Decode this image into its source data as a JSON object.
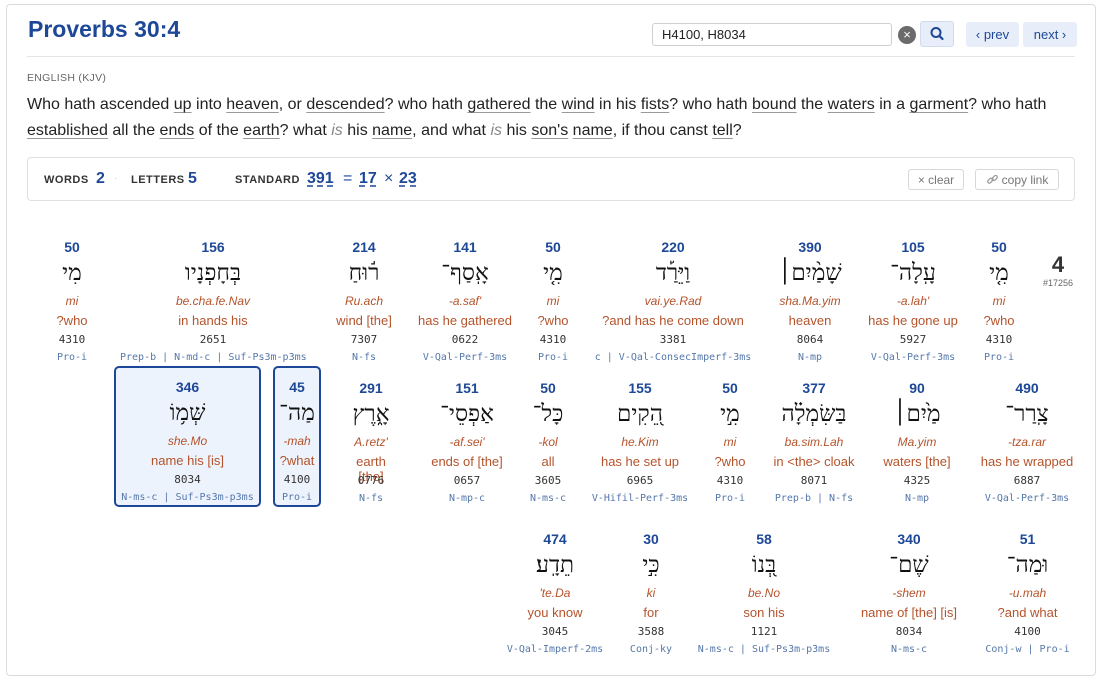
{
  "header": {
    "title": "Proverbs 30:4",
    "search_value": "H4100, H8034",
    "prev_label": "‹ prev",
    "next_label": "next ›"
  },
  "verse": {
    "language_label": "ENGLISH (KJV)",
    "segments": [
      {
        "t": "Who hath ascended "
      },
      {
        "t": "up",
        "k": true
      },
      {
        "t": " into "
      },
      {
        "t": "heaven",
        "k": true
      },
      {
        "t": ", or "
      },
      {
        "t": "descended",
        "k": true
      },
      {
        "t": "? who hath "
      },
      {
        "t": "gathered",
        "k": true
      },
      {
        "t": " the "
      },
      {
        "t": "wind",
        "k": true
      },
      {
        "t": " in his "
      },
      {
        "t": "fists",
        "k": true
      },
      {
        "t": "? who hath "
      },
      {
        "t": "bound",
        "k": true
      },
      {
        "t": " the "
      },
      {
        "t": "waters",
        "k": true
      },
      {
        "t": " in a "
      },
      {
        "t": "garment",
        "k": true
      },
      {
        "t": "? who hath "
      },
      {
        "t": "established",
        "k": true
      },
      {
        "t": " all the "
      },
      {
        "t": "ends",
        "k": true
      },
      {
        "t": " of the "
      },
      {
        "t": "earth",
        "k": true
      },
      {
        "t": "? what "
      },
      {
        "t": "is",
        "i": true
      },
      {
        "t": " his "
      },
      {
        "t": "name",
        "k": true
      },
      {
        "t": ", and what "
      },
      {
        "t": "is",
        "i": true
      },
      {
        "t": " his "
      },
      {
        "t": "son's",
        "k": true
      },
      {
        "t": " "
      },
      {
        "t": "name",
        "k": true
      },
      {
        "t": ", if thou canst "
      },
      {
        "t": "tell",
        "k": true
      },
      {
        "t": "?"
      }
    ]
  },
  "stats": {
    "words_label": "WORDS",
    "words_value": "2",
    "letters_label": "LETTERS",
    "letters_value": "5",
    "standard_label": "STANDARD",
    "standard_value": "391",
    "eq": "=",
    "factor1": "17",
    "times": "×",
    "factor2": "23",
    "clear_label": "× clear",
    "copy_label": "copy link"
  },
  "verse_number": "4",
  "verse_total": "#17256",
  "words": [
    {
      "value": "50",
      "hebrew": "מִי",
      "translit": "mi",
      "gloss": "?who",
      "strongs": "4310",
      "morph": "Pro-i",
      "selected": false
    },
    {
      "value": "156",
      "hebrew": "בְּחָפְנָיו",
      "translit": "be.cha.fe.Nav",
      "gloss": "in hands his",
      "strongs": "2651",
      "morph": "Prep-b | N-md-c | Suf-Ps3m-p3ms",
      "selected": false
    },
    {
      "value": "214",
      "hebrew": "ר֬וּחַ",
      "translit": "Ru.ach",
      "gloss": "wind [the]",
      "strongs": "7307",
      "morph": "N-fs",
      "selected": false
    },
    {
      "value": "141",
      "hebrew": "אָֽסַף־",
      "translit": "-a.saf'",
      "gloss": "has he gathered",
      "strongs": "0622",
      "morph": "V-Qal-Perf-3ms",
      "selected": false
    },
    {
      "value": "50",
      "hebrew": "מִ֤י",
      "translit": "mi",
      "gloss": "?who",
      "strongs": "4310",
      "morph": "Pro-i",
      "selected": false
    },
    {
      "value": "220",
      "hebrew": "וַיֵּרַ֡ד",
      "translit": "vai.ye.Rad",
      "gloss": "?and has he come down",
      "strongs": "3381",
      "morph": "c | V-Qal-ConsecImperf-3ms",
      "selected": false
    },
    {
      "value": "390",
      "hebrew": "שָׁמַ֨יִם׀",
      "translit": "sha.Ma.yim",
      "gloss": "heaven",
      "strongs": "8064",
      "morph": "N-mp",
      "selected": false
    },
    {
      "value": "105",
      "hebrew": "עָֽלָה־",
      "translit": "-a.lah'",
      "gloss": "has he gone up",
      "strongs": "5927",
      "morph": "V-Qal-Perf-3ms",
      "selected": false
    },
    {
      "value": "50",
      "hebrew": "מִ֤י",
      "translit": "mi",
      "gloss": "?who",
      "strongs": "4310",
      "morph": "Pro-i",
      "selected": false
    },
    {
      "value": "346",
      "hebrew": "שְּׁמ֥וֹ",
      "translit": "she.Mo",
      "gloss": "name his [is]",
      "strongs": "8034",
      "morph": "N-ms-c | Suf-Ps3m-p3ms",
      "selected": true
    },
    {
      "value": "45",
      "hebrew": "מַה־",
      "translit": "-mah",
      "gloss": "?what",
      "strongs": "4100",
      "morph": "Pro-i",
      "selected": true
    },
    {
      "value": "291",
      "hebrew": "אָ֑רֶץ",
      "translit": "A.retz'",
      "gloss": "earth [the]",
      "strongs": "0776",
      "morph": "N-fs",
      "selected": false
    },
    {
      "value": "151",
      "hebrew": "אַפְסֵי־",
      "translit": "-af.sei'",
      "gloss": "ends of [the]",
      "strongs": "0657",
      "morph": "N-mp-c",
      "selected": false
    },
    {
      "value": "50",
      "hebrew": "כָּל־",
      "translit": "-kol",
      "gloss": "all",
      "strongs": "3605",
      "morph": "N-ms-c",
      "selected": false
    },
    {
      "value": "155",
      "hebrew": "הֵ֭קִים",
      "translit": "he.Kim",
      "gloss": "has he set up",
      "strongs": "6965",
      "morph": "V-Hifil-Perf-3ms",
      "selected": false
    },
    {
      "value": "50",
      "hebrew": "מִ֣י",
      "translit": "mi",
      "gloss": "?who",
      "strongs": "4310",
      "morph": "Pro-i",
      "selected": false
    },
    {
      "value": "377",
      "hebrew": "בַּשִּׂמְלָ֗ה",
      "translit": "ba.sim.Lah",
      "gloss": "in <the> cloak",
      "strongs": "8071",
      "morph": "Prep-b | N-fs",
      "selected": false
    },
    {
      "value": "90",
      "hebrew": "מַ֙יִם׀",
      "translit": "Ma.yim",
      "gloss": "waters [the]",
      "strongs": "4325",
      "morph": "N-mp",
      "selected": false
    },
    {
      "value": "490",
      "hebrew": "צָֽרַר־",
      "translit": "-tza.rar",
      "gloss": "has he wrapped",
      "strongs": "6887",
      "morph": "V-Qal-Perf-3ms",
      "selected": false
    },
    {
      "value": "474",
      "hebrew": "תֵדָֽע׃",
      "translit": "'te.Da",
      "gloss": "you know",
      "strongs": "3045",
      "morph": "V-Qal-Imperf-2ms",
      "selected": false
    },
    {
      "value": "30",
      "hebrew": "כִּ֣י",
      "translit": "ki",
      "gloss": "for",
      "strongs": "3588",
      "morph": "Conj-ky",
      "selected": false
    },
    {
      "value": "58",
      "hebrew": "בְּ֭נוֹ",
      "translit": "be.No",
      "gloss": "son his",
      "strongs": "1121",
      "morph": "N-ms-c | Suf-Ps3m-p3ms",
      "selected": false
    },
    {
      "value": "340",
      "hebrew": "שֶׁם־",
      "translit": "-shem",
      "gloss": "name of [the] [is]",
      "strongs": "8034",
      "morph": "N-ms-c",
      "selected": false
    },
    {
      "value": "51",
      "hebrew": "וּמַה־",
      "translit": "-u.mah",
      "gloss": "?and what",
      "strongs": "4100",
      "morph": "Conj-w | Pro-i",
      "selected": false
    }
  ]
}
